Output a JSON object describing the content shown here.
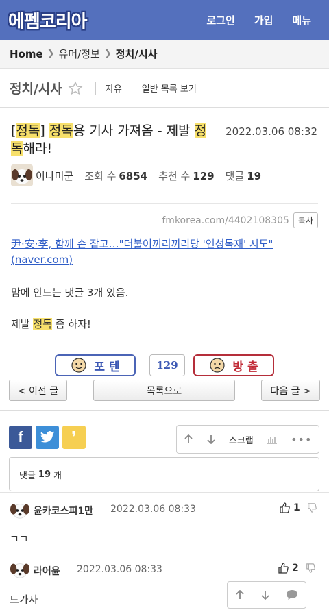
{
  "header": {
    "logo_text": "에펨코리아",
    "nav": [
      "로그인",
      "가입",
      "메뉴"
    ]
  },
  "breadcrumb": {
    "home": "Home",
    "middle": "유머/정보",
    "current": "정치/시사"
  },
  "board": {
    "title": "정치/시사",
    "links": [
      "자유",
      "일반 목록 보기"
    ]
  },
  "post": {
    "title_parts": [
      {
        "text": "[",
        "hl": false
      },
      {
        "text": "정독",
        "hl": true
      },
      {
        "text": "] ",
        "hl": false
      },
      {
        "text": "정독",
        "hl": true
      },
      {
        "text": "용 기사 가져옴 - 제발 ",
        "hl": false
      },
      {
        "text": "정독",
        "hl": true
      },
      {
        "text": "해라!",
        "hl": false
      }
    ],
    "date": "2022.03.06 08:32",
    "author": "이나미군",
    "views_label": "조회 수",
    "views": "6854",
    "recommend_label": "추천 수",
    "recommend": "129",
    "comments_label": "댓글",
    "comments": "19",
    "source_url": "fmkorea.com/4402108305",
    "copy_label": "복사",
    "news_link": "尹·安·李, 함께 손 잡고…\"더불어끼리끼리당 '연성독재' 시도\" (naver.com)",
    "body_line1": "맘에 안드는 댓글 3개 있음.",
    "body_line2_pre": "제발 ",
    "body_line2_hl": "정독",
    "body_line2_post": " 좀 하자!"
  },
  "vote": {
    "up_label": "포 텐",
    "count": "129",
    "down_label": "방 출"
  },
  "navigation": {
    "prev": "< 이전 글",
    "list": "목록으로",
    "next": "다음 글 >"
  },
  "actions": {
    "scrap": "스크랩"
  },
  "comment_summary": {
    "prefix": "댓글",
    "count": "19",
    "suffix": "개"
  },
  "comments": [
    {
      "name": "윤카코스피1만",
      "date": "2022.03.06 08:33",
      "likes": "1",
      "text": "ㄱㄱ"
    },
    {
      "name": "라어윤",
      "date": "2022.03.06 08:33",
      "likes": "2",
      "text": "드가자"
    }
  ],
  "colors": {
    "header_bg": "#5470bd",
    "highlight": "#f7e06b",
    "link": "#2f5dc7",
    "vote_up": "#4b64b6",
    "vote_down": "#b52e3a"
  }
}
